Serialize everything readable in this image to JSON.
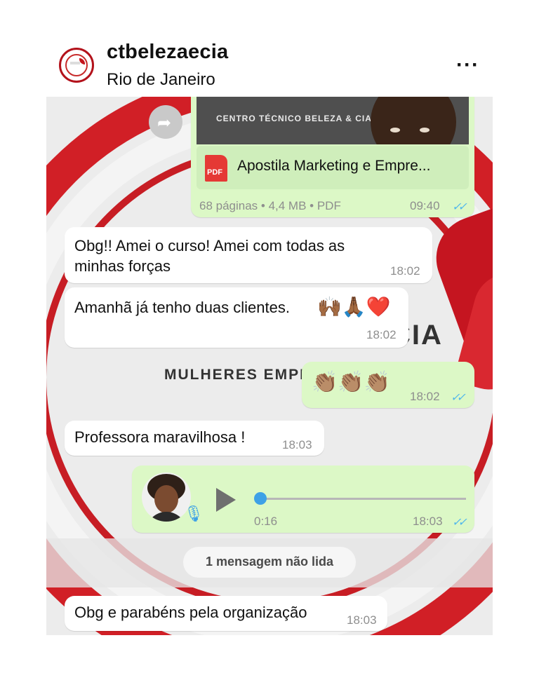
{
  "header": {
    "username": "ctbelezaecia",
    "location": "Rio de Janeiro",
    "more": "···"
  },
  "background": {
    "brand_text": "CIA",
    "sub_text": "MULHERES EMPR"
  },
  "chat": {
    "document": {
      "preview_title": "CENTRO TÉCNICO BELEZA & CIA",
      "icon_label": "PDF",
      "name": "Apostila Marketing e Empre...",
      "meta": "68 páginas • 4,4 MB • PDF",
      "time": "09:40",
      "ticks": "✓✓"
    },
    "messages": [
      {
        "text_line1": "Obg!! Amei o curso! Amei com todas as",
        "text_line2": "minhas forças",
        "time": "18:02"
      },
      {
        "text": "Amanhã já tenho duas clientes.",
        "emoji": "🙌🏾🙏🏾❤️",
        "time": "18:02"
      },
      {
        "emoji": "👏🏽👏🏽👏🏽",
        "time": "18:02",
        "ticks": "✓✓"
      },
      {
        "text": "Professora maravilhosa !",
        "time": "18:03"
      }
    ],
    "voice": {
      "duration": "0:16",
      "time": "18:03",
      "ticks": "✓✓",
      "progress": 0
    },
    "unread_divider": "1 mensagem não lida",
    "last_message": {
      "text": "Obg e parabéns pela organização",
      "time": "18:03"
    }
  }
}
